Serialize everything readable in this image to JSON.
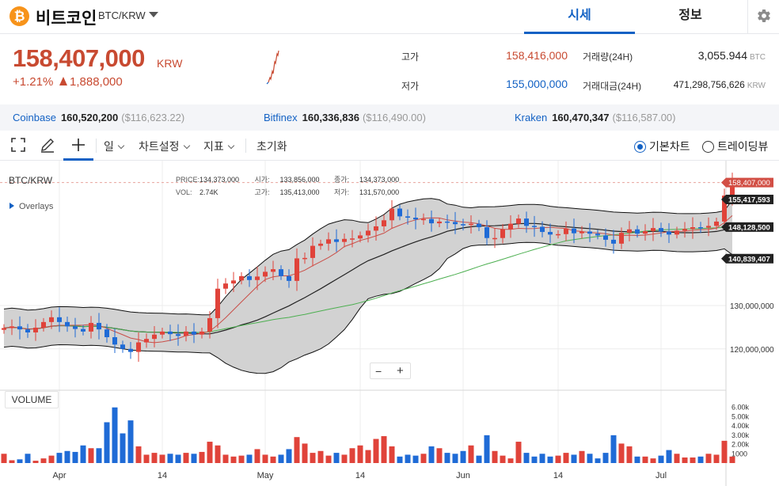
{
  "header": {
    "coin_logo": "₿",
    "coin_name": "비트코인",
    "coin_pair": "BTC/KRW",
    "tabs": [
      {
        "label": "시세"
      },
      {
        "label": "정보"
      }
    ]
  },
  "price": {
    "current": "158,407,000",
    "unit": "KRW",
    "change_rate": "+1.21%",
    "change_amount": "1,888,000",
    "up_color": "#c84a31",
    "down_color": "#1261c4"
  },
  "stats": {
    "high_label": "고가",
    "high_value": "158,416,000",
    "low_label": "저가",
    "low_value": "155,000,000",
    "volume_label": "거래량(24H)",
    "volume_value": "3,055.944",
    "volume_unit": "BTC",
    "amount_label": "거래대금(24H)",
    "amount_value": "471,298,756,626",
    "amount_unit": "KRW"
  },
  "exchanges": [
    {
      "name": "Coinbase",
      "price": "160,520,200",
      "usd": "($116,623.22)"
    },
    {
      "name": "Bitfinex",
      "price": "160,336,836",
      "usd": "($116,490.00)"
    },
    {
      "name": "Kraken",
      "price": "160,470,347",
      "usd": "($116,587.00)"
    }
  ],
  "toolbar": {
    "icons": [
      "fullscreen-icon",
      "pencil-icon",
      "crosshair-icon"
    ],
    "period": "일",
    "chart_settings": "차트설정",
    "indicators": "지표",
    "reset": "초기화",
    "view_basic": "기본차트",
    "view_tradingview": "트레이딩뷰"
  },
  "chart_info": {
    "symbol": "BTC/KRW",
    "overlays": "Overlays",
    "price_label": "PRICE:",
    "price": "134,373,000",
    "open_label": "시가:",
    "open": "133,856,000",
    "close_label": "종가:",
    "close": "134,373,000",
    "vol_label": "VOL:",
    "vol": "2.74K",
    "high_label": "고가:",
    "high": "135,413,000",
    "low_label": "저가:",
    "low": "131,570,000",
    "volume_panel": "VOLUME",
    "zoom_out": "−",
    "zoom_in": "+"
  },
  "chart_data": {
    "type": "candlestick",
    "ylim": [
      111000000,
      162000000
    ],
    "y_ticks": [
      {
        "label": "120,000,000",
        "value": 120000000
      },
      {
        "label": "130,000,000",
        "value": 130000000
      }
    ],
    "price_tags": [
      {
        "label": "158,407,000",
        "value": 158407000,
        "color": "#d24f45"
      },
      {
        "label": "155,417,593",
        "value": 155417593,
        "color": "#222222"
      },
      {
        "label": "148,128,500",
        "value": 148128500,
        "color": "#222222"
      },
      {
        "label": "140,839,407",
        "value": 140839407,
        "color": "#222222"
      }
    ],
    "x_ticks": [
      {
        "label": "Apr",
        "index": 7
      },
      {
        "label": "14",
        "index": 20
      },
      {
        "label": "May",
        "index": 33
      },
      {
        "label": "14",
        "index": 45
      },
      {
        "label": "Jun",
        "index": 58
      },
      {
        "label": "14",
        "index": 70
      },
      {
        "label": "Jul",
        "index": 83
      }
    ],
    "volume_ticks": [
      "6.00k",
      "5.00k",
      "4.00k",
      "3.00k",
      "2.00k",
      "1000"
    ],
    "volume_ylim": [
      0,
      7000
    ],
    "closes": [
      124.8,
      125.2,
      124.5,
      123.8,
      124.9,
      126.2,
      127.3,
      126.2,
      125.2,
      124.6,
      124.0,
      126.0,
      124.5,
      122.7,
      121.0,
      120.0,
      119.3,
      121.5,
      122.3,
      123.3,
      124.0,
      123.4,
      123.0,
      124.0,
      123.3,
      124.0,
      127.1,
      133.9,
      135.1,
      135.8,
      136.8,
      135.9,
      136.7,
      137.8,
      138.4,
      136.8,
      135.7,
      140.9,
      141.0,
      143.8,
      144.3,
      145.3,
      144.7,
      145.4,
      145.5,
      146.2,
      147.3,
      148.3,
      149.7,
      152.4,
      150.6,
      150.3,
      149.9,
      150.0,
      149.0,
      149.4,
      149.3,
      148.8,
      148.6,
      148.9,
      148.1,
      145.6,
      145.6,
      147.6,
      148.9,
      150.1,
      148.4,
      148.2,
      147.0,
      146.4,
      146.5,
      147.8,
      146.7,
      147.1,
      146.6,
      146.2,
      145.2,
      144.3,
      146.8,
      147.6,
      146.6,
      147.2,
      147.9,
      147.1,
      146.4,
      147.3,
      147.7,
      148.1,
      148.0,
      148.4,
      149.4,
      155.4,
      158.4
    ],
    "volumes": [
      1000,
      300,
      400,
      1000,
      250,
      500,
      800,
      1100,
      1300,
      1200,
      1900,
      1600,
      1600,
      4400,
      6000,
      3200,
      4600,
      1800,
      900,
      1100,
      900,
      1000,
      900,
      1100,
      1000,
      1200,
      2300,
      1900,
      900,
      700,
      800,
      900,
      1500,
      900,
      700,
      900,
      1500,
      2800,
      2100,
      1100,
      1300,
      800,
      1100,
      900,
      1600,
      1900,
      1400,
      2600,
      2900,
      1800,
      700,
      900,
      800,
      1000,
      1800,
      1600,
      1100,
      1000,
      1300,
      1900,
      800,
      3000,
      1300,
      800,
      500,
      2300,
      1100,
      700,
      1000,
      700,
      800,
      1100,
      900,
      1300,
      1000,
      500,
      1100,
      3000,
      2100,
      1800,
      700,
      700,
      500,
      800,
      1400,
      1000,
      600,
      600,
      700,
      1000,
      900,
      2400,
      700
    ],
    "bollinger_mid_color": "#222222",
    "bollinger_fill_color": "#d2d2d2",
    "ma_short_color": "#c94f48",
    "ma_long_color": "#4caf50"
  }
}
